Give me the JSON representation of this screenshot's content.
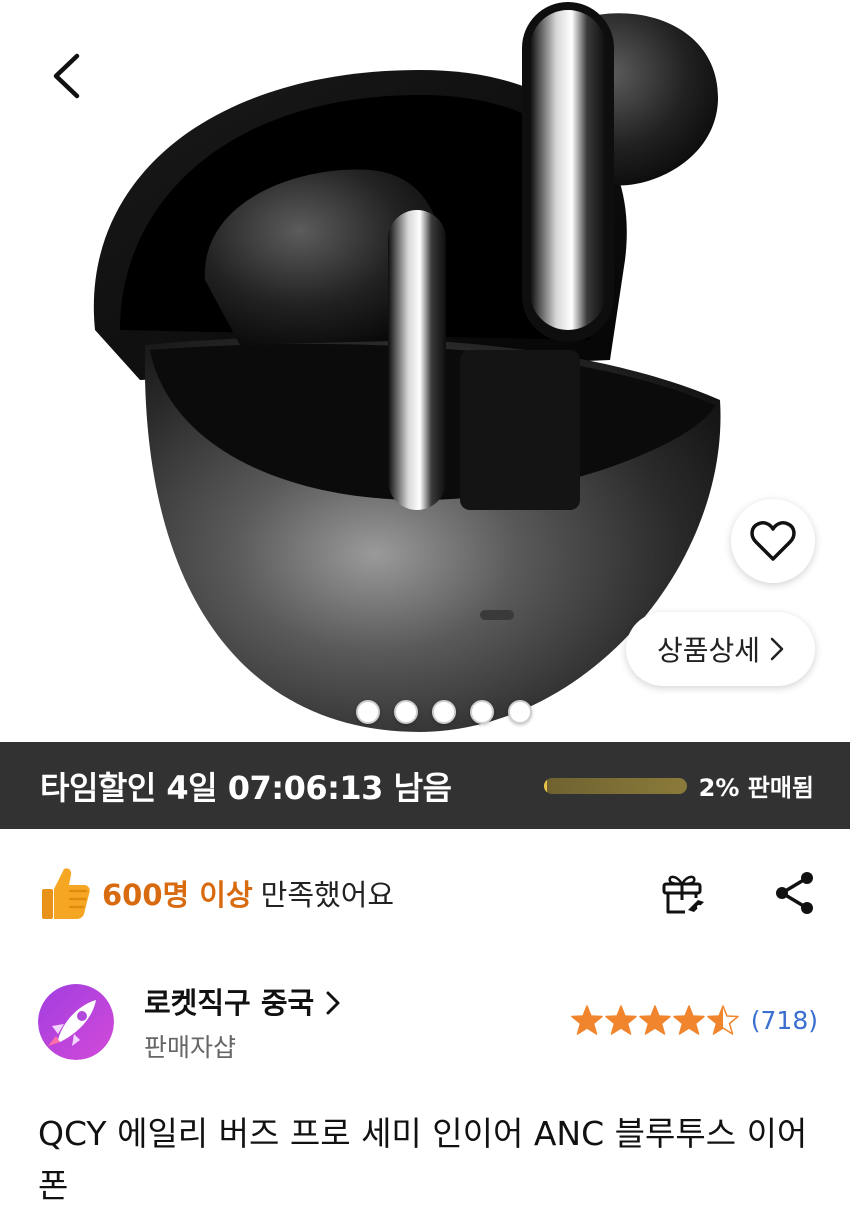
{
  "hero": {
    "image_alt": "QCY earbuds in black charging case",
    "detail_button_label": "상품상세",
    "image_dots_count": 5,
    "active_dot": 0
  },
  "deal": {
    "countdown_text": "타임할인 4일 07:06:13 남음",
    "sold_percent": 2,
    "sold_label": "2% 판매됨"
  },
  "satisfaction": {
    "highlight": "600명 이상",
    "rest": "만족했어요"
  },
  "seller": {
    "name": "로켓직구 중국",
    "sub": "판매자샵",
    "rating": 4.5,
    "review_count": "(718)"
  },
  "product": {
    "title": "QCY 에일리 버즈 프로 세미 인이어 ANC 블루투스 이어폰"
  },
  "colors": {
    "accent_orange": "#d86a10",
    "deal_bar_bg": "#323232",
    "review_link": "#3a6fd0",
    "star": "#f0852d"
  }
}
